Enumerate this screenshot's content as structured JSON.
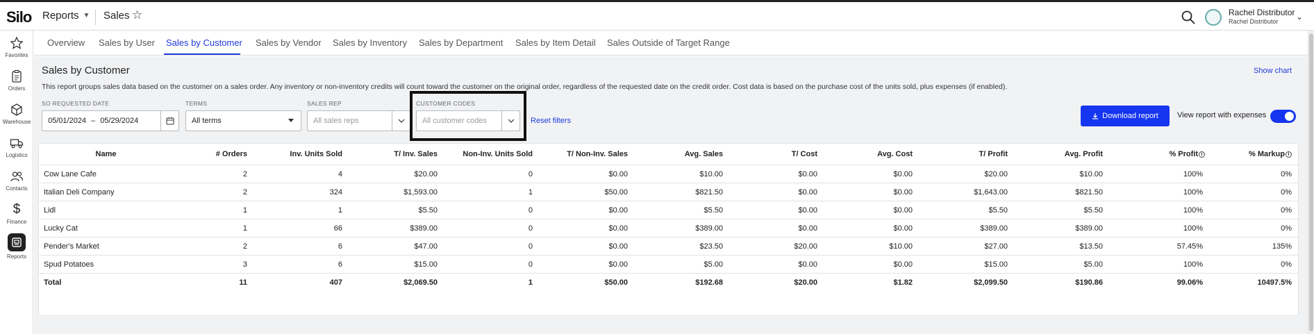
{
  "app": {
    "logo": "Silo",
    "menu_label": "Reports",
    "page_name": "Sales"
  },
  "user": {
    "name": "Rachel Distributor",
    "sub": "Rachel Distributor"
  },
  "sidebar": [
    {
      "label": "Favorites",
      "icon": "star-icon"
    },
    {
      "label": "Orders",
      "icon": "clipboard-icon"
    },
    {
      "label": "Warehouse",
      "icon": "cube-icon"
    },
    {
      "label": "Logistics",
      "icon": "truck-icon"
    },
    {
      "label": "Contacts",
      "icon": "people-icon"
    },
    {
      "label": "Finance",
      "icon": "dollar-icon"
    },
    {
      "label": "Reports",
      "icon": "report-icon",
      "active": true
    }
  ],
  "tabs": [
    {
      "label": "Overview"
    },
    {
      "label": "Sales by User"
    },
    {
      "label": "Sales by Customer",
      "active": true
    },
    {
      "label": "Sales by Vendor"
    },
    {
      "label": "Sales by Inventory"
    },
    {
      "label": "Sales by Department"
    },
    {
      "label": "Sales by Item Detail"
    },
    {
      "label": "Sales Outside of Target Range"
    }
  ],
  "report": {
    "title": "Sales by Customer",
    "show_chart": "Show chart",
    "description": "This report groups sales data based on the customer on a sales order. Any inventory or non-inventory credits will count toward the customer on the original order, regardless of the requested date on the credit order. Cost data is based on the purchase cost of the units sold, plus expenses (if enabled)."
  },
  "filters": {
    "date": {
      "label": "SO REQUESTED DATE",
      "start": "05/01/2024",
      "sep": "–",
      "end": "05/29/2024"
    },
    "terms": {
      "label": "TERMS",
      "value": "All terms"
    },
    "sales_rep": {
      "label": "SALES REP",
      "placeholder": "All sales reps"
    },
    "customer_codes": {
      "label": "CUSTOMER CODES",
      "placeholder": "All customer codes"
    },
    "reset": "Reset filters"
  },
  "actions": {
    "download": "Download report",
    "toggle_label": "View report with expenses",
    "toggle_on": true
  },
  "table": {
    "columns": [
      "Name",
      "# Orders",
      "Inv. Units Sold",
      "T/ Inv. Sales",
      "Non-Inv. Units Sold",
      "T/ Non-Inv. Sales",
      "Avg. Sales",
      "T/ Cost",
      "Avg. Cost",
      "T/ Profit",
      "Avg. Profit",
      "% Profit",
      "% Markup"
    ],
    "rows": [
      [
        "Cow Lane Cafe",
        "2",
        "4",
        "$20.00",
        "0",
        "$0.00",
        "$10.00",
        "$0.00",
        "$0.00",
        "$20.00",
        "$10.00",
        "100%",
        "0%"
      ],
      [
        "Italian Deli Company",
        "2",
        "324",
        "$1,593.00",
        "1",
        "$50.00",
        "$821.50",
        "$0.00",
        "$0.00",
        "$1,643.00",
        "$821.50",
        "100%",
        "0%"
      ],
      [
        "Lidl",
        "1",
        "1",
        "$5.50",
        "0",
        "$0.00",
        "$5.50",
        "$0.00",
        "$0.00",
        "$5.50",
        "$5.50",
        "100%",
        "0%"
      ],
      [
        "Lucky Cat",
        "1",
        "66",
        "$389.00",
        "0",
        "$0.00",
        "$389.00",
        "$0.00",
        "$0.00",
        "$389.00",
        "$389.00",
        "100%",
        "0%"
      ],
      [
        "Pender's Market",
        "2",
        "6",
        "$47.00",
        "0",
        "$0.00",
        "$23.50",
        "$20.00",
        "$10.00",
        "$27.00",
        "$13.50",
        "57.45%",
        "135%"
      ],
      [
        "Spud Potatoes",
        "3",
        "6",
        "$15.00",
        "0",
        "$0.00",
        "$5.00",
        "$0.00",
        "$0.00",
        "$15.00",
        "$5.00",
        "100%",
        "0%"
      ]
    ],
    "total": [
      "Total",
      "11",
      "407",
      "$2,069.50",
      "1",
      "$50.00",
      "$192.68",
      "$20.00",
      "$1.82",
      "$2,099.50",
      "$190.86",
      "99.06%",
      "10497.5%"
    ]
  },
  "colors": {
    "accent": "#1d3ad8",
    "primary_button": "#1535f0"
  }
}
